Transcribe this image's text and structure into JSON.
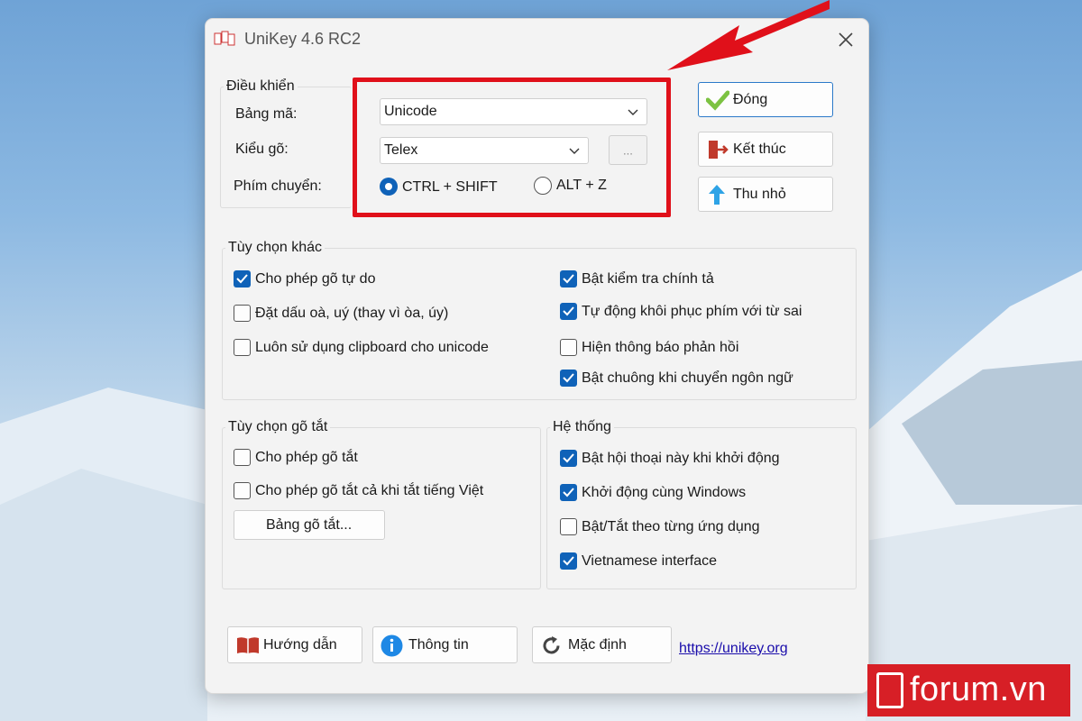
{
  "window": {
    "title": "UniKey 4.6 RC2"
  },
  "dieu_khien": {
    "legend": "Điều khiển",
    "bang_ma_label": "Bảng mã:",
    "bang_ma_value": "Unicode",
    "kieu_go_label": "Kiểu gõ:",
    "kieu_go_value": "Telex",
    "ellipsis_label": "...",
    "phim_chuyen_label": "Phím chuyển:",
    "radio1_label": "CTRL + SHIFT",
    "radio2_label": "ALT + Z"
  },
  "side_buttons": {
    "dong": "Đóng",
    "ket_thuc": "Kết thúc",
    "thu_nho": "Thu nhỏ"
  },
  "tuy_chon_khac": {
    "legend": "Tùy chọn khác",
    "items": [
      {
        "label": "Cho phép gõ tự do",
        "checked": true
      },
      {
        "label": "Đặt dấu oà, uý (thay vì òa, úy)",
        "checked": false
      },
      {
        "label": "Luôn sử dụng clipboard cho unicode",
        "checked": false
      },
      {
        "label": "Bật kiểm tra chính tả",
        "checked": true
      },
      {
        "label": "Tự động khôi phục phím với từ sai",
        "checked": true
      },
      {
        "label": "Hiện thông báo phản hồi",
        "checked": false
      },
      {
        "label": "Bật chuông khi chuyển ngôn ngữ",
        "checked": true
      }
    ]
  },
  "go_tat": {
    "legend": "Tùy chọn gõ tắt",
    "items": [
      {
        "label": "Cho phép gõ tắt",
        "checked": false
      },
      {
        "label": "Cho phép gõ tắt cả khi tắt tiếng Việt",
        "checked": false
      }
    ],
    "button": "Bảng gõ tắt..."
  },
  "he_thong": {
    "legend": "Hệ thống",
    "items": [
      {
        "label": "Bật hội thoại này khi khởi động",
        "checked": true
      },
      {
        "label": "Khởi động cùng Windows",
        "checked": true
      },
      {
        "label": "Bật/Tắt theo từng ứng dụng",
        "checked": false
      },
      {
        "label": "Vietnamese interface",
        "checked": true
      }
    ]
  },
  "bottom": {
    "huong_dan": "Hướng dẫn",
    "thong_tin": "Thông tin",
    "mac_dinh": "Mặc định",
    "link": "https://unikey.org"
  },
  "watermark": {
    "text": "forum.vn"
  },
  "colors": {
    "accent": "#0f62b8",
    "highlight": "#e0101a",
    "brand": "#d71f26"
  }
}
